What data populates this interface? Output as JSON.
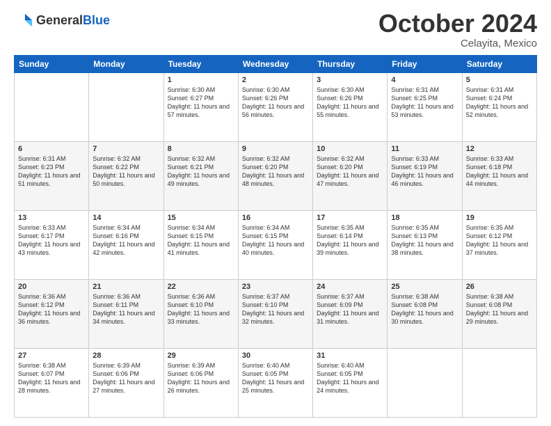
{
  "header": {
    "logo_general": "General",
    "logo_blue": "Blue",
    "month": "October 2024",
    "location": "Celayita, Mexico"
  },
  "days_of_week": [
    "Sunday",
    "Monday",
    "Tuesday",
    "Wednesday",
    "Thursday",
    "Friday",
    "Saturday"
  ],
  "weeks": [
    [
      {
        "day": "",
        "info": ""
      },
      {
        "day": "",
        "info": ""
      },
      {
        "day": "1",
        "info": "Sunrise: 6:30 AM\nSunset: 6:27 PM\nDaylight: 11 hours and 57 minutes."
      },
      {
        "day": "2",
        "info": "Sunrise: 6:30 AM\nSunset: 6:26 PM\nDaylight: 11 hours and 56 minutes."
      },
      {
        "day": "3",
        "info": "Sunrise: 6:30 AM\nSunset: 6:26 PM\nDaylight: 11 hours and 55 minutes."
      },
      {
        "day": "4",
        "info": "Sunrise: 6:31 AM\nSunset: 6:25 PM\nDaylight: 11 hours and 53 minutes."
      },
      {
        "day": "5",
        "info": "Sunrise: 6:31 AM\nSunset: 6:24 PM\nDaylight: 11 hours and 52 minutes."
      }
    ],
    [
      {
        "day": "6",
        "info": "Sunrise: 6:31 AM\nSunset: 6:23 PM\nDaylight: 11 hours and 51 minutes."
      },
      {
        "day": "7",
        "info": "Sunrise: 6:32 AM\nSunset: 6:22 PM\nDaylight: 11 hours and 50 minutes."
      },
      {
        "day": "8",
        "info": "Sunrise: 6:32 AM\nSunset: 6:21 PM\nDaylight: 11 hours and 49 minutes."
      },
      {
        "day": "9",
        "info": "Sunrise: 6:32 AM\nSunset: 6:20 PM\nDaylight: 11 hours and 48 minutes."
      },
      {
        "day": "10",
        "info": "Sunrise: 6:32 AM\nSunset: 6:20 PM\nDaylight: 11 hours and 47 minutes."
      },
      {
        "day": "11",
        "info": "Sunrise: 6:33 AM\nSunset: 6:19 PM\nDaylight: 11 hours and 46 minutes."
      },
      {
        "day": "12",
        "info": "Sunrise: 6:33 AM\nSunset: 6:18 PM\nDaylight: 11 hours and 44 minutes."
      }
    ],
    [
      {
        "day": "13",
        "info": "Sunrise: 6:33 AM\nSunset: 6:17 PM\nDaylight: 11 hours and 43 minutes."
      },
      {
        "day": "14",
        "info": "Sunrise: 6:34 AM\nSunset: 6:16 PM\nDaylight: 11 hours and 42 minutes."
      },
      {
        "day": "15",
        "info": "Sunrise: 6:34 AM\nSunset: 6:15 PM\nDaylight: 11 hours and 41 minutes."
      },
      {
        "day": "16",
        "info": "Sunrise: 6:34 AM\nSunset: 6:15 PM\nDaylight: 11 hours and 40 minutes."
      },
      {
        "day": "17",
        "info": "Sunrise: 6:35 AM\nSunset: 6:14 PM\nDaylight: 11 hours and 39 minutes."
      },
      {
        "day": "18",
        "info": "Sunrise: 6:35 AM\nSunset: 6:13 PM\nDaylight: 11 hours and 38 minutes."
      },
      {
        "day": "19",
        "info": "Sunrise: 6:35 AM\nSunset: 6:12 PM\nDaylight: 11 hours and 37 minutes."
      }
    ],
    [
      {
        "day": "20",
        "info": "Sunrise: 6:36 AM\nSunset: 6:12 PM\nDaylight: 11 hours and 36 minutes."
      },
      {
        "day": "21",
        "info": "Sunrise: 6:36 AM\nSunset: 6:11 PM\nDaylight: 11 hours and 34 minutes."
      },
      {
        "day": "22",
        "info": "Sunrise: 6:36 AM\nSunset: 6:10 PM\nDaylight: 11 hours and 33 minutes."
      },
      {
        "day": "23",
        "info": "Sunrise: 6:37 AM\nSunset: 6:10 PM\nDaylight: 11 hours and 32 minutes."
      },
      {
        "day": "24",
        "info": "Sunrise: 6:37 AM\nSunset: 6:09 PM\nDaylight: 11 hours and 31 minutes."
      },
      {
        "day": "25",
        "info": "Sunrise: 6:38 AM\nSunset: 6:08 PM\nDaylight: 11 hours and 30 minutes."
      },
      {
        "day": "26",
        "info": "Sunrise: 6:38 AM\nSunset: 6:08 PM\nDaylight: 11 hours and 29 minutes."
      }
    ],
    [
      {
        "day": "27",
        "info": "Sunrise: 6:38 AM\nSunset: 6:07 PM\nDaylight: 11 hours and 28 minutes."
      },
      {
        "day": "28",
        "info": "Sunrise: 6:39 AM\nSunset: 6:06 PM\nDaylight: 11 hours and 27 minutes."
      },
      {
        "day": "29",
        "info": "Sunrise: 6:39 AM\nSunset: 6:06 PM\nDaylight: 11 hours and 26 minutes."
      },
      {
        "day": "30",
        "info": "Sunrise: 6:40 AM\nSunset: 6:05 PM\nDaylight: 11 hours and 25 minutes."
      },
      {
        "day": "31",
        "info": "Sunrise: 6:40 AM\nSunset: 6:05 PM\nDaylight: 11 hours and 24 minutes."
      },
      {
        "day": "",
        "info": ""
      },
      {
        "day": "",
        "info": ""
      }
    ]
  ]
}
